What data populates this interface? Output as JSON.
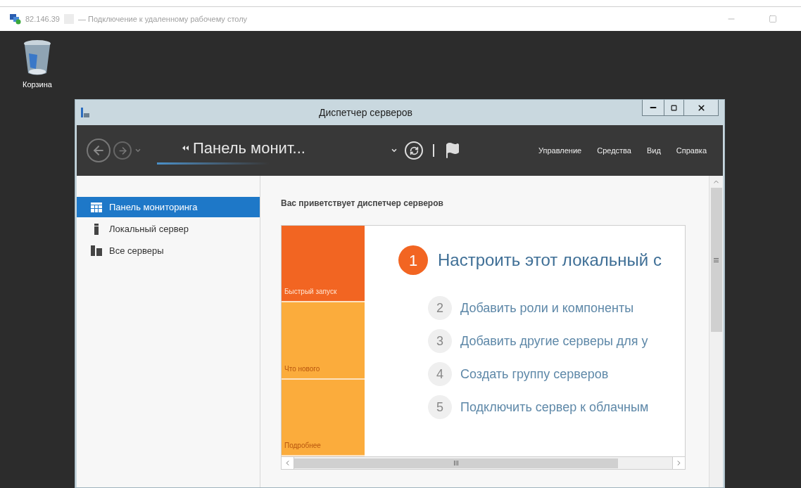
{
  "rdp_window": {
    "address": "82.146.39",
    "title": "— Подключение к удаленному рабочему столу"
  },
  "desktop_icons": [
    {
      "label": "Корзина"
    }
  ],
  "server_manager": {
    "title": "Диспетчер серверов",
    "breadcrumb": "Панель монит...",
    "menu": [
      "Управление",
      "Средства",
      "Вид",
      "Справка"
    ],
    "nav_items": [
      {
        "label": "Панель мониторинга",
        "selected": true,
        "kind": "dashboard"
      },
      {
        "label": "Локальный сервер",
        "selected": false,
        "kind": "server"
      },
      {
        "label": "Все серверы",
        "selected": false,
        "kind": "servers"
      }
    ],
    "welcome_heading": "Вас приветствует диспетчер серверов",
    "tiles": [
      {
        "label": "Быстрый запуск",
        "selected": true
      },
      {
        "label": "Что нового",
        "selected": false
      },
      {
        "label": "Подробнее",
        "selected": false
      }
    ],
    "steps": [
      {
        "number": "1",
        "label": "Настроить этот локальный с",
        "primary": true
      },
      {
        "number": "2",
        "label": "Добавить роли и компоненты",
        "primary": false
      },
      {
        "number": "3",
        "label": "Добавить другие серверы для у",
        "primary": false
      },
      {
        "number": "4",
        "label": "Создать группу серверов",
        "primary": false
      },
      {
        "number": "5",
        "label": "Подключить сервер к облачным",
        "primary": false
      }
    ]
  }
}
